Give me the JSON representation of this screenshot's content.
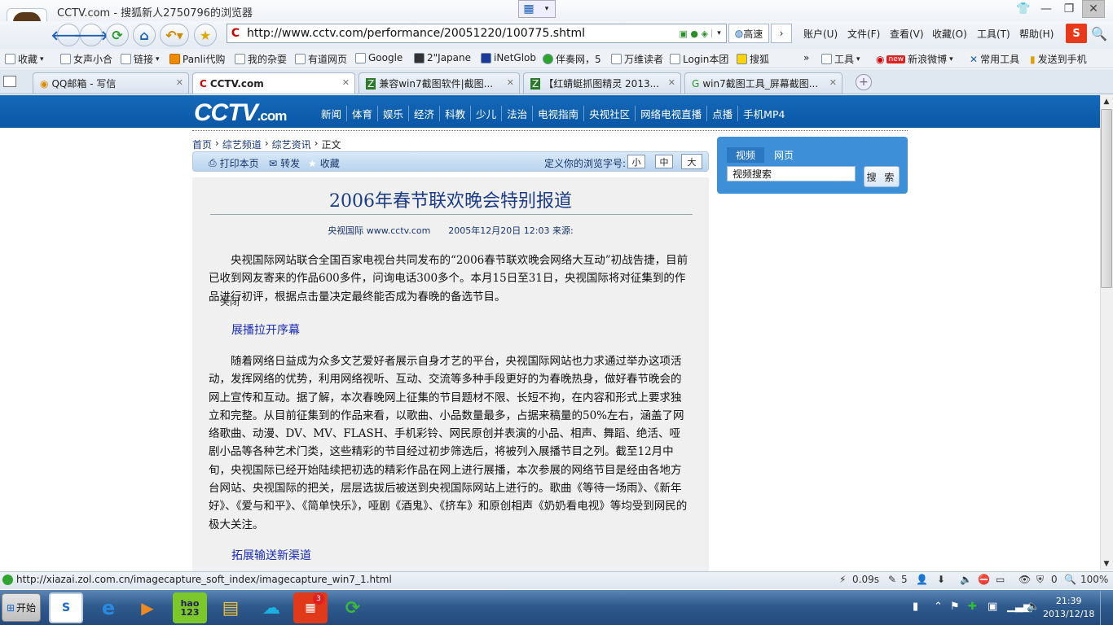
{
  "window": {
    "title": "CCTV.com - 搜狐新人2750796的浏览器"
  },
  "address_bar": {
    "url": "http://www.cctv.com/performance/20051220/100775.shtml",
    "go_site": "高速"
  },
  "menus": [
    "账户(U)",
    "文件(F)",
    "查看(V)",
    "收藏(O)",
    "工具(T)",
    "帮助(H)"
  ],
  "bookmarks": [
    "收藏",
    "女声小合",
    "链接",
    "Panli代购",
    "我的杂耍",
    "有道网页",
    "Google",
    "2\"Japane",
    "iNetGlob",
    "伴奏网，5",
    "万维读者",
    "Login本团",
    "搜狐"
  ],
  "bookmarks_right": [
    "工具",
    "新浪微博",
    "常用工具",
    "发送到手机"
  ],
  "new_badge": "new",
  "tabs": [
    {
      "label": "QQ邮箱 - 写信"
    },
    {
      "label": "CCTV.com"
    },
    {
      "label": "兼容win7截图软件|截图..."
    },
    {
      "label": "【红蜻蜓抓图精灵 2013..."
    },
    {
      "label": "win7截图工具_屏幕截图..."
    }
  ],
  "cctv": {
    "logo_main": "CCTV",
    "logo_suffix": ".com",
    "nav": [
      "新闻",
      "体育",
      "娱乐",
      "经济",
      "科教",
      "少儿",
      "法治",
      "电视指南",
      "央视社区",
      "网络电视直播",
      "点播",
      "手机MP4"
    ]
  },
  "breadcrumb": {
    "home": "首页",
    "c1": "综艺频道",
    "c2": "综艺资讯",
    "current": "正文"
  },
  "article_tools": {
    "print": "打印本页",
    "forward": "转发",
    "favorite": "收藏",
    "font_label": "定义你的浏览字号:",
    "small": "小",
    "medium": "中",
    "large": "大"
  },
  "article": {
    "title": "2006年春节联欢晚会特别报道",
    "meta": "央视国际 www.cctv.com　　2005年12月20日 12:03 来源:",
    "p1": "央视国际网站联合全国百家电视台共同发布的“2006春节联欢晚会网络大互动”初战告捷，目前已收到网友寄来的作品600多件，问询电话300多个。本月15日至31日，央视国际将对征集到的作品进行初评，根据点击量决定最终能否成为春晚的备选节目。",
    "overlap": "关闭",
    "sub1": "展播拉开序幕",
    "p2": "随着网络日益成为众多文艺爱好者展示自身才艺的平台，央视国际网站也力求通过举办这项活动，发挥网络的优势，利用网络视听、互动、交流等多种手段更好的为春晚热身，做好春节晚会的网上宣传和互动。据了解，本次春晚网上征集的节目题材不限、长短不拘，在内容和形式上要求独立和完整。从目前征集到的作品来看，以歌曲、小品数量最多，占据来稿量的50%左右，涵盖了网络歌曲、动漫、DV、MV、FLASH、手机彩铃、网民原创并表演的小品、相声、舞蹈、绝活、哑剧小品等各种艺术门类，这些精彩的节目经过初步筛选后，将被列入展播节目之列。截至12月中旬，央视国际已经开始陆续把初选的精彩作品在网上进行展播，本次参展的网络节目是经由各地方台网站、央视国际的把关，层层选拔后被送到央视国际网站上进行的。歌曲《等待一场雨》、《新年好》、《爱与和平》、《简单快乐》，哑剧《酒鬼》、《挤车》和原创相声《奶奶看电视》等均受到网民的极大关注。",
    "sub2": "拓展输送新渠道"
  },
  "video_search": {
    "tab_video": "视频",
    "tab_web": "网页",
    "input_value": "视频搜索",
    "button": "搜 索"
  },
  "status": {
    "url": "http://xiazai.zol.com.cn/imagecapture_soft_index/imagecapture_win7_1.html",
    "speed": "0.09s",
    "count": "5",
    "blocked": "0",
    "zoom": "100%"
  },
  "taskbar": {
    "start": "开始",
    "time": "21:39",
    "date": "2013/12/18",
    "hao123": "hao\n123",
    "badge": "3"
  }
}
